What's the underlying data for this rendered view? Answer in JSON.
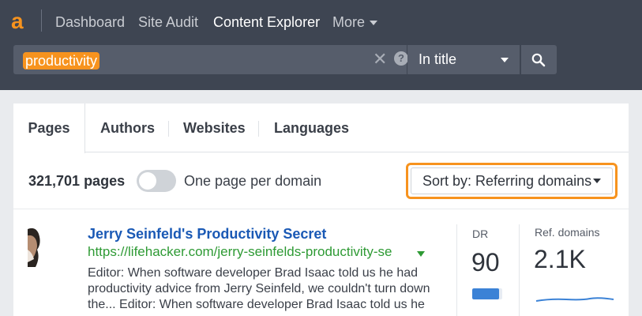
{
  "nav": {
    "logo_letter": "a",
    "items": [
      {
        "label": "Dashboard"
      },
      {
        "label": "Site Audit"
      },
      {
        "label": "Content Explorer"
      },
      {
        "label": "More"
      }
    ]
  },
  "search": {
    "value": "productivity",
    "mode": "In title"
  },
  "tabs": [
    {
      "label": "Pages"
    },
    {
      "label": "Authors"
    },
    {
      "label": "Websites"
    },
    {
      "label": "Languages"
    }
  ],
  "controls": {
    "count": "321,701 pages",
    "toggle_label": "One page per domain",
    "toggle_on": false,
    "sort_label": "Sort by: Referring domains"
  },
  "result": {
    "title": "Jerry Seinfeld's Productivity Secret",
    "url": "https://lifehacker.com/jerry-seinfelds-productivity-se",
    "desc_lines": [
      "Editor: When software developer Brad Isaac told us he had",
      "productivity advice from Jerry Seinfeld, we couldn't turn down",
      "the... Editor: When software developer Brad Isaac told us he"
    ],
    "dr_label": "DR",
    "dr_value": "90",
    "dr_fraction": 0.9,
    "ref_label": "Ref. domains",
    "ref_value": "2.1K"
  },
  "colors": {
    "accent": "#f7931e",
    "topbar": "#3e4552",
    "link": "#1a59b5",
    "url": "#2e9a34",
    "bar": "#3b82d6"
  }
}
